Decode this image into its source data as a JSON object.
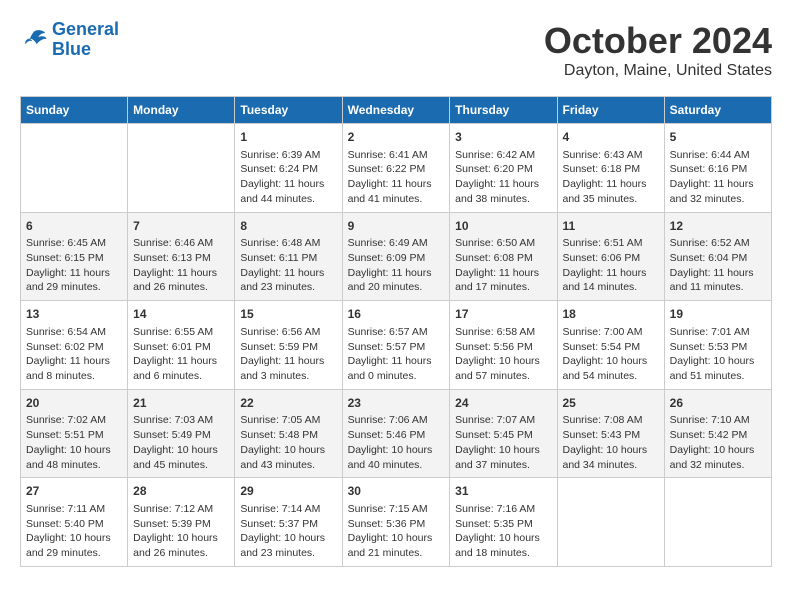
{
  "header": {
    "logo_line1": "General",
    "logo_line2": "Blue",
    "title": "October 2024",
    "subtitle": "Dayton, Maine, United States"
  },
  "days_of_week": [
    "Sunday",
    "Monday",
    "Tuesday",
    "Wednesday",
    "Thursday",
    "Friday",
    "Saturday"
  ],
  "weeks": [
    [
      {
        "day": "",
        "sunrise": "",
        "sunset": "",
        "daylight": ""
      },
      {
        "day": "",
        "sunrise": "",
        "sunset": "",
        "daylight": ""
      },
      {
        "day": "1",
        "sunrise": "Sunrise: 6:39 AM",
        "sunset": "Sunset: 6:24 PM",
        "daylight": "Daylight: 11 hours and 44 minutes."
      },
      {
        "day": "2",
        "sunrise": "Sunrise: 6:41 AM",
        "sunset": "Sunset: 6:22 PM",
        "daylight": "Daylight: 11 hours and 41 minutes."
      },
      {
        "day": "3",
        "sunrise": "Sunrise: 6:42 AM",
        "sunset": "Sunset: 6:20 PM",
        "daylight": "Daylight: 11 hours and 38 minutes."
      },
      {
        "day": "4",
        "sunrise": "Sunrise: 6:43 AM",
        "sunset": "Sunset: 6:18 PM",
        "daylight": "Daylight: 11 hours and 35 minutes."
      },
      {
        "day": "5",
        "sunrise": "Sunrise: 6:44 AM",
        "sunset": "Sunset: 6:16 PM",
        "daylight": "Daylight: 11 hours and 32 minutes."
      }
    ],
    [
      {
        "day": "6",
        "sunrise": "Sunrise: 6:45 AM",
        "sunset": "Sunset: 6:15 PM",
        "daylight": "Daylight: 11 hours and 29 minutes."
      },
      {
        "day": "7",
        "sunrise": "Sunrise: 6:46 AM",
        "sunset": "Sunset: 6:13 PM",
        "daylight": "Daylight: 11 hours and 26 minutes."
      },
      {
        "day": "8",
        "sunrise": "Sunrise: 6:48 AM",
        "sunset": "Sunset: 6:11 PM",
        "daylight": "Daylight: 11 hours and 23 minutes."
      },
      {
        "day": "9",
        "sunrise": "Sunrise: 6:49 AM",
        "sunset": "Sunset: 6:09 PM",
        "daylight": "Daylight: 11 hours and 20 minutes."
      },
      {
        "day": "10",
        "sunrise": "Sunrise: 6:50 AM",
        "sunset": "Sunset: 6:08 PM",
        "daylight": "Daylight: 11 hours and 17 minutes."
      },
      {
        "day": "11",
        "sunrise": "Sunrise: 6:51 AM",
        "sunset": "Sunset: 6:06 PM",
        "daylight": "Daylight: 11 hours and 14 minutes."
      },
      {
        "day": "12",
        "sunrise": "Sunrise: 6:52 AM",
        "sunset": "Sunset: 6:04 PM",
        "daylight": "Daylight: 11 hours and 11 minutes."
      }
    ],
    [
      {
        "day": "13",
        "sunrise": "Sunrise: 6:54 AM",
        "sunset": "Sunset: 6:02 PM",
        "daylight": "Daylight: 11 hours and 8 minutes."
      },
      {
        "day": "14",
        "sunrise": "Sunrise: 6:55 AM",
        "sunset": "Sunset: 6:01 PM",
        "daylight": "Daylight: 11 hours and 6 minutes."
      },
      {
        "day": "15",
        "sunrise": "Sunrise: 6:56 AM",
        "sunset": "Sunset: 5:59 PM",
        "daylight": "Daylight: 11 hours and 3 minutes."
      },
      {
        "day": "16",
        "sunrise": "Sunrise: 6:57 AM",
        "sunset": "Sunset: 5:57 PM",
        "daylight": "Daylight: 11 hours and 0 minutes."
      },
      {
        "day": "17",
        "sunrise": "Sunrise: 6:58 AM",
        "sunset": "Sunset: 5:56 PM",
        "daylight": "Daylight: 10 hours and 57 minutes."
      },
      {
        "day": "18",
        "sunrise": "Sunrise: 7:00 AM",
        "sunset": "Sunset: 5:54 PM",
        "daylight": "Daylight: 10 hours and 54 minutes."
      },
      {
        "day": "19",
        "sunrise": "Sunrise: 7:01 AM",
        "sunset": "Sunset: 5:53 PM",
        "daylight": "Daylight: 10 hours and 51 minutes."
      }
    ],
    [
      {
        "day": "20",
        "sunrise": "Sunrise: 7:02 AM",
        "sunset": "Sunset: 5:51 PM",
        "daylight": "Daylight: 10 hours and 48 minutes."
      },
      {
        "day": "21",
        "sunrise": "Sunrise: 7:03 AM",
        "sunset": "Sunset: 5:49 PM",
        "daylight": "Daylight: 10 hours and 45 minutes."
      },
      {
        "day": "22",
        "sunrise": "Sunrise: 7:05 AM",
        "sunset": "Sunset: 5:48 PM",
        "daylight": "Daylight: 10 hours and 43 minutes."
      },
      {
        "day": "23",
        "sunrise": "Sunrise: 7:06 AM",
        "sunset": "Sunset: 5:46 PM",
        "daylight": "Daylight: 10 hours and 40 minutes."
      },
      {
        "day": "24",
        "sunrise": "Sunrise: 7:07 AM",
        "sunset": "Sunset: 5:45 PM",
        "daylight": "Daylight: 10 hours and 37 minutes."
      },
      {
        "day": "25",
        "sunrise": "Sunrise: 7:08 AM",
        "sunset": "Sunset: 5:43 PM",
        "daylight": "Daylight: 10 hours and 34 minutes."
      },
      {
        "day": "26",
        "sunrise": "Sunrise: 7:10 AM",
        "sunset": "Sunset: 5:42 PM",
        "daylight": "Daylight: 10 hours and 32 minutes."
      }
    ],
    [
      {
        "day": "27",
        "sunrise": "Sunrise: 7:11 AM",
        "sunset": "Sunset: 5:40 PM",
        "daylight": "Daylight: 10 hours and 29 minutes."
      },
      {
        "day": "28",
        "sunrise": "Sunrise: 7:12 AM",
        "sunset": "Sunset: 5:39 PM",
        "daylight": "Daylight: 10 hours and 26 minutes."
      },
      {
        "day": "29",
        "sunrise": "Sunrise: 7:14 AM",
        "sunset": "Sunset: 5:37 PM",
        "daylight": "Daylight: 10 hours and 23 minutes."
      },
      {
        "day": "30",
        "sunrise": "Sunrise: 7:15 AM",
        "sunset": "Sunset: 5:36 PM",
        "daylight": "Daylight: 10 hours and 21 minutes."
      },
      {
        "day": "31",
        "sunrise": "Sunrise: 7:16 AM",
        "sunset": "Sunset: 5:35 PM",
        "daylight": "Daylight: 10 hours and 18 minutes."
      },
      {
        "day": "",
        "sunrise": "",
        "sunset": "",
        "daylight": ""
      },
      {
        "day": "",
        "sunrise": "",
        "sunset": "",
        "daylight": ""
      }
    ]
  ]
}
